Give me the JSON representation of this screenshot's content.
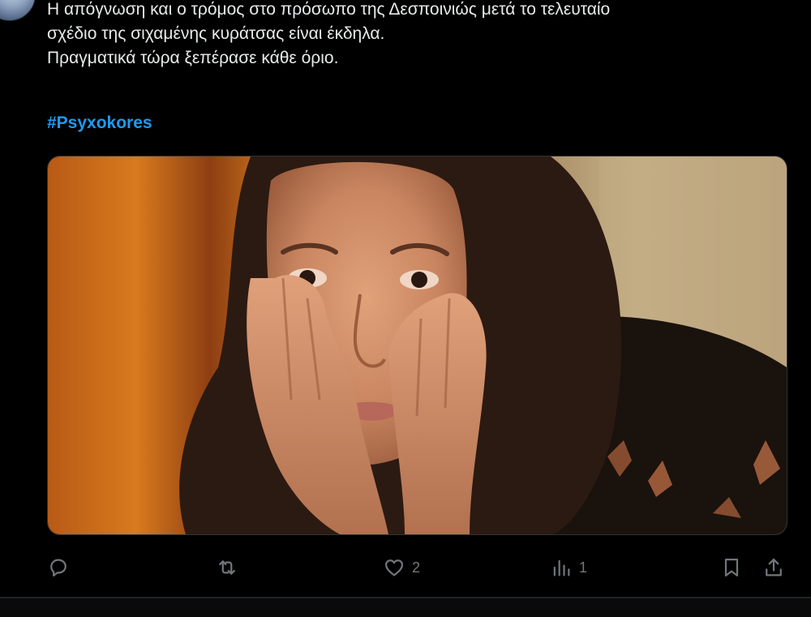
{
  "tweet": {
    "lines": [
      "Η απόγνωση και ο τρόμος στο πρόσωπο της Δεσποινιώς μετά το τελευταίο",
      "σχέδιο της σιχαμένης κυράτσας είναι έκδηλα.",
      "Πραγματικά τώρα ξεπέρασε κάθε όριο."
    ],
    "hashtag": "#Psyxokores"
  },
  "actions": {
    "reply": {
      "icon": "reply-icon",
      "count": ""
    },
    "repost": {
      "icon": "repost-icon",
      "count": ""
    },
    "like": {
      "icon": "heart-icon",
      "count": "2"
    },
    "views": {
      "icon": "views-icon",
      "count": "1"
    },
    "bookmark": {
      "icon": "bookmark-icon"
    },
    "share": {
      "icon": "share-icon"
    }
  },
  "colors": {
    "background": "#000000",
    "text": "#e7e9ea",
    "muted": "#71767b",
    "link": "#1d9bf0",
    "border": "#2f3336"
  }
}
